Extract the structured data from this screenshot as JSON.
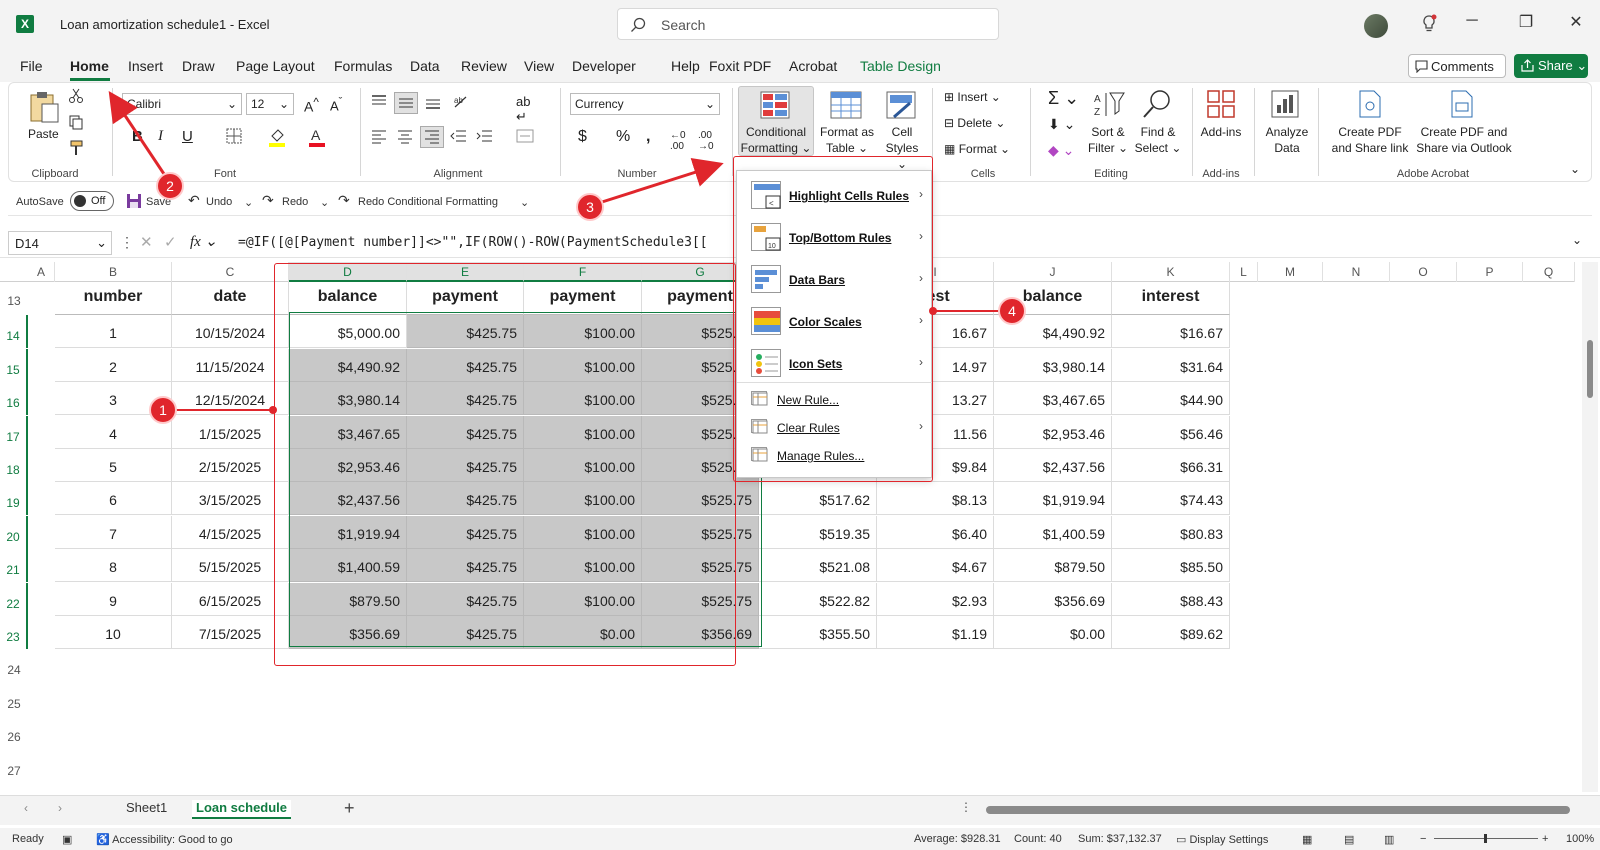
{
  "window": {
    "title": "Loan amortization schedule1 - Excel",
    "app_icon": "X"
  },
  "search": {
    "placeholder": "Search"
  },
  "menu": [
    "File",
    "Home",
    "Insert",
    "Draw",
    "Page Layout",
    "Formulas",
    "Data",
    "Review",
    "View",
    "Developer",
    "Help",
    "Foxit PDF",
    "Acrobat",
    "Table Design"
  ],
  "menu_active": "Home",
  "buttons": {
    "comments": "Comments",
    "share": "Share"
  },
  "ribbon": {
    "clipboard": {
      "paste": "Paste",
      "label": "Clipboard"
    },
    "font": {
      "name": "Calibri",
      "size": "12",
      "label": "Font"
    },
    "alignment": {
      "label": "Alignment"
    },
    "number": {
      "format": "Currency",
      "label": "Number"
    },
    "styles": {
      "conditional_formatting_1": "Conditional",
      "conditional_formatting_2": "Formatting",
      "format_as_table_1": "Format as",
      "format_as_table_2": "Table",
      "cell_styles_1": "Cell",
      "cell_styles_2": "Styles"
    },
    "cells": {
      "insert": "Insert",
      "delete": "Delete",
      "format": "Format",
      "label": "Cells"
    },
    "editing": {
      "sort_1": "Sort &",
      "sort_2": "Filter",
      "find_1": "Find &",
      "find_2": "Select",
      "label": "Editing"
    },
    "addins": {
      "addins": "Add-ins",
      "label": "Add-ins"
    },
    "analyze": {
      "line1": "Analyze",
      "line2": "Data"
    },
    "acrobat": {
      "pdf1_1": "Create PDF",
      "pdf1_2": "and Share link",
      "pdf2_1": "Create PDF and",
      "pdf2_2": "Share via Outlook",
      "label": "Adobe Acrobat"
    }
  },
  "qat": {
    "autosave": "AutoSave",
    "toggle": "Off",
    "save": "Save",
    "undo": "Undo",
    "redo": "Redo",
    "redo_cf": "Redo Conditional Formatting"
  },
  "formula_bar": {
    "name_box": "D14",
    "fx": "fx",
    "formula": "=@IF([@[Payment number]]<>\"\",IF(ROW()-ROW(PaymentSchedule3[["
  },
  "columns": [
    "A",
    "B",
    "C",
    "D",
    "E",
    "F",
    "G",
    "H",
    "I",
    "J",
    "K",
    "L",
    "M",
    "N",
    "O",
    "P",
    "Q"
  ],
  "header_row": {
    "B": "number",
    "C": "date",
    "D": "balance",
    "E": "payment",
    "F": "payment",
    "G": "payment",
    "I": "rest",
    "J": "balance",
    "K": "interest"
  },
  "rows": [
    {
      "r": "14",
      "B": "1",
      "C": "10/15/2024",
      "D": "$5,000.00",
      "E": "$425.75",
      "F": "$100.00",
      "G": "$525.75",
      "I": "16.67",
      "J": "$4,490.92",
      "K": "$16.67"
    },
    {
      "r": "15",
      "B": "2",
      "C": "11/15/2024",
      "D": "$4,490.92",
      "E": "$425.75",
      "F": "$100.00",
      "G": "$525.75",
      "I": "14.97",
      "J": "$3,980.14",
      "K": "$31.64"
    },
    {
      "r": "16",
      "B": "3",
      "C": "12/15/2024",
      "D": "$3,980.14",
      "E": "$425.75",
      "F": "$100.00",
      "G": "$525.75",
      "I": "13.27",
      "J": "$3,467.65",
      "K": "$44.90"
    },
    {
      "r": "17",
      "B": "4",
      "C": "1/15/2025",
      "D": "$3,467.65",
      "E": "$425.75",
      "F": "$100.00",
      "G": "$525.75",
      "I": "11.56",
      "J": "$2,953.46",
      "K": "$56.46"
    },
    {
      "r": "18",
      "B": "5",
      "C": "2/15/2025",
      "D": "$2,953.46",
      "E": "$425.75",
      "F": "$100.00",
      "G": "$525.75",
      "I": "$9.84",
      "J": "$2,437.56",
      "K": "$66.31"
    },
    {
      "r": "19",
      "B": "6",
      "C": "3/15/2025",
      "D": "$2,437.56",
      "E": "$425.75",
      "F": "$100.00",
      "G": "$525.75",
      "H": "$517.62",
      "I": "$8.13",
      "J": "$1,919.94",
      "K": "$74.43"
    },
    {
      "r": "20",
      "B": "7",
      "C": "4/15/2025",
      "D": "$1,919.94",
      "E": "$425.75",
      "F": "$100.00",
      "G": "$525.75",
      "H": "$519.35",
      "I": "$6.40",
      "J": "$1,400.59",
      "K": "$80.83"
    },
    {
      "r": "21",
      "B": "8",
      "C": "5/15/2025",
      "D": "$1,400.59",
      "E": "$425.75",
      "F": "$100.00",
      "G": "$525.75",
      "H": "$521.08",
      "I": "$4.67",
      "J": "$879.50",
      "K": "$85.50"
    },
    {
      "r": "22",
      "B": "9",
      "C": "6/15/2025",
      "D": "$879.50",
      "E": "$425.75",
      "F": "$100.00",
      "G": "$525.75",
      "H": "$522.82",
      "I": "$2.93",
      "J": "$356.69",
      "K": "$88.43"
    },
    {
      "r": "23",
      "B": "10",
      "C": "7/15/2025",
      "D": "$356.69",
      "E": "$425.75",
      "F": "$0.00",
      "G": "$356.69",
      "H": "$355.50",
      "I": "$1.19",
      "J": "$0.00",
      "K": "$89.62"
    }
  ],
  "row_numbers": [
    "13",
    "14",
    "15",
    "16",
    "17",
    "18",
    "19",
    "20",
    "21",
    "22",
    "23",
    "24",
    "25",
    "26",
    "27"
  ],
  "cf_menu": [
    {
      "label": "Highlight Cells Rules",
      "sub": true
    },
    {
      "label": "Top/Bottom Rules",
      "sub": true
    },
    {
      "label": "Data Bars",
      "sub": true
    },
    {
      "label": "Color Scales",
      "sub": true
    },
    {
      "label": "Icon Sets",
      "sub": true
    },
    {
      "label": "New Rule...",
      "sub": false
    },
    {
      "label": "Clear Rules",
      "sub": true
    },
    {
      "label": "Manage Rules...",
      "sub": false
    }
  ],
  "annotations": [
    "1",
    "2",
    "3",
    "4"
  ],
  "sheets": [
    "Sheet1",
    "Loan schedule"
  ],
  "active_sheet": "Loan schedule",
  "status": {
    "ready": "Ready",
    "accessibility": "Accessibility: Good to go",
    "average": "Average: $928.31",
    "count": "Count: 40",
    "sum": "Sum: $37,132.37",
    "display": "Display Settings",
    "zoom": "100%"
  },
  "colors": {
    "excel_green": "#107c41",
    "annotation_red": "#e0262c",
    "selection_shade": "#c8c8c8"
  }
}
